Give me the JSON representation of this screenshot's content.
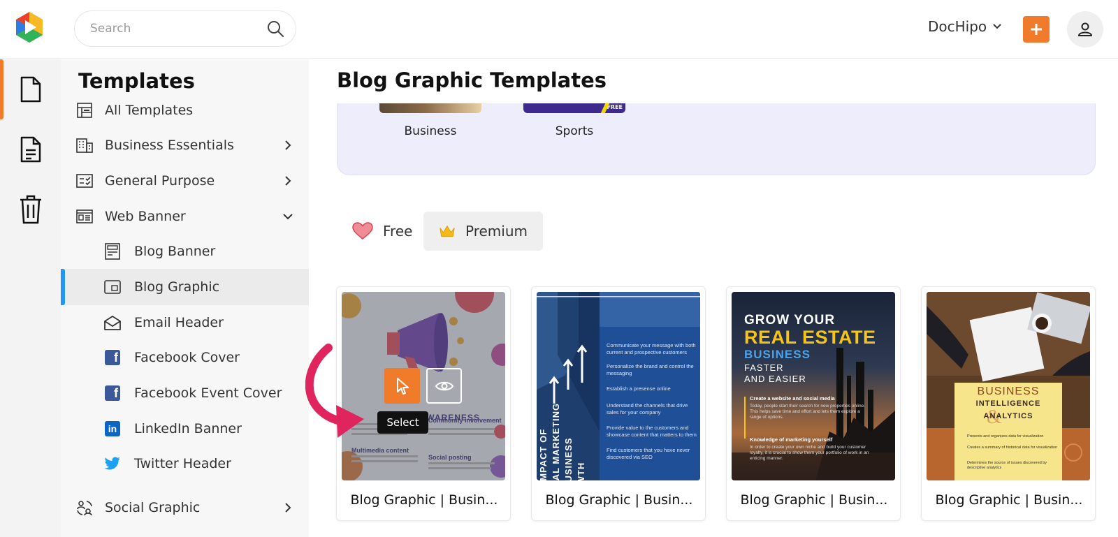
{
  "header": {
    "search_placeholder": "Search",
    "brand": "DocHipo",
    "add_icon": "plus-icon",
    "avatar_icon": "user-icon"
  },
  "rail": {
    "items": [
      {
        "icon": "document-icon",
        "active": true
      },
      {
        "icon": "file-text-icon",
        "active": false
      },
      {
        "icon": "trash-icon",
        "active": false
      }
    ]
  },
  "sidebar": {
    "title": "Templates",
    "items": [
      {
        "label": "All Templates",
        "icon": "layout-icon"
      },
      {
        "label": "Business Essentials",
        "icon": "building-icon"
      },
      {
        "label": "General Purpose",
        "icon": "checklist-icon"
      },
      {
        "label": "Web Banner",
        "icon": "web-banner-icon"
      },
      {
        "label": "Blog Banner",
        "icon": "blog-banner-icon"
      },
      {
        "label": "Blog Graphic",
        "icon": "blog-graphic-icon"
      },
      {
        "label": "Email Header",
        "icon": "email-icon"
      },
      {
        "label": "Facebook Cover",
        "icon": "facebook-icon"
      },
      {
        "label": "Facebook Event Cover",
        "icon": "facebook-icon"
      },
      {
        "label": "LinkedIn Banner",
        "icon": "linkedin-icon"
      },
      {
        "label": "Twitter Header",
        "icon": "twitter-icon"
      },
      {
        "label": "Social Graphic",
        "icon": "social-graphic-icon"
      }
    ]
  },
  "main": {
    "title": "Blog Graphic Templates",
    "categories": [
      {
        "name": "Business"
      },
      {
        "name": "Sports",
        "thumb_badge": "FREE"
      }
    ],
    "filters": [
      {
        "label": "Free",
        "icon": "heart-icon"
      },
      {
        "label": "Premium",
        "icon": "crown-icon"
      }
    ],
    "tooltip": "Select",
    "cards": [
      {
        "title": "Blog Graphic | Busin...",
        "img": {
          "headline": "BRAND AWARENESS",
          "col1a": "Community involvement",
          "col1b": "Social posting",
          "col2": "Multimedia content"
        }
      },
      {
        "title": "Blog Graphic | Busin...",
        "img": {
          "vertical": "THE IMPACT OF DIGITAL MARKETING ON BUSINESS GROWTH",
          "bullets": [
            "Communicate your message with both current and prospective customers",
            "Personalize the brand and control the messaging",
            "Establish a presense online",
            "Understand the channels that drive sales for your company",
            "Provide value to the customers and showcase content that matters to them",
            "Find customers that you have never discovered via SEO"
          ]
        }
      },
      {
        "title": "Blog Graphic | Busin...",
        "img": {
          "line1": "GROW YOUR",
          "line2": "REAL ESTATE",
          "line3": "BUSINESS",
          "line4": "FASTER",
          "line5": "AND EASIER",
          "sub1": "Create a website and social media",
          "body1": "Today, people start their search for new properties online. This helps save time and effort and lets them explore a range of options.",
          "sub2": "Knowledge of marketing yourself",
          "body2": "In order to create your own niche and build your customer loyalty, it is crucial to show them your portfolio of work in an enticing manner."
        }
      },
      {
        "title": "Blog Graphic | Busin...",
        "img": {
          "line1": "BUSINESS",
          "line2": "INTELLIGENCE",
          "line3": "ANALYTICS",
          "b1": "Presents and organizes data for visualization",
          "b2": "Creates a summary of historical data for visualization",
          "b3": "Determines the source of issues discovered by descriptive analytics"
        }
      }
    ]
  },
  "colors": {
    "accent": "#f07c2b",
    "selected_indicator": "#2196f3",
    "category_bg": "#eeedfb",
    "arrow": "#e0245e"
  }
}
